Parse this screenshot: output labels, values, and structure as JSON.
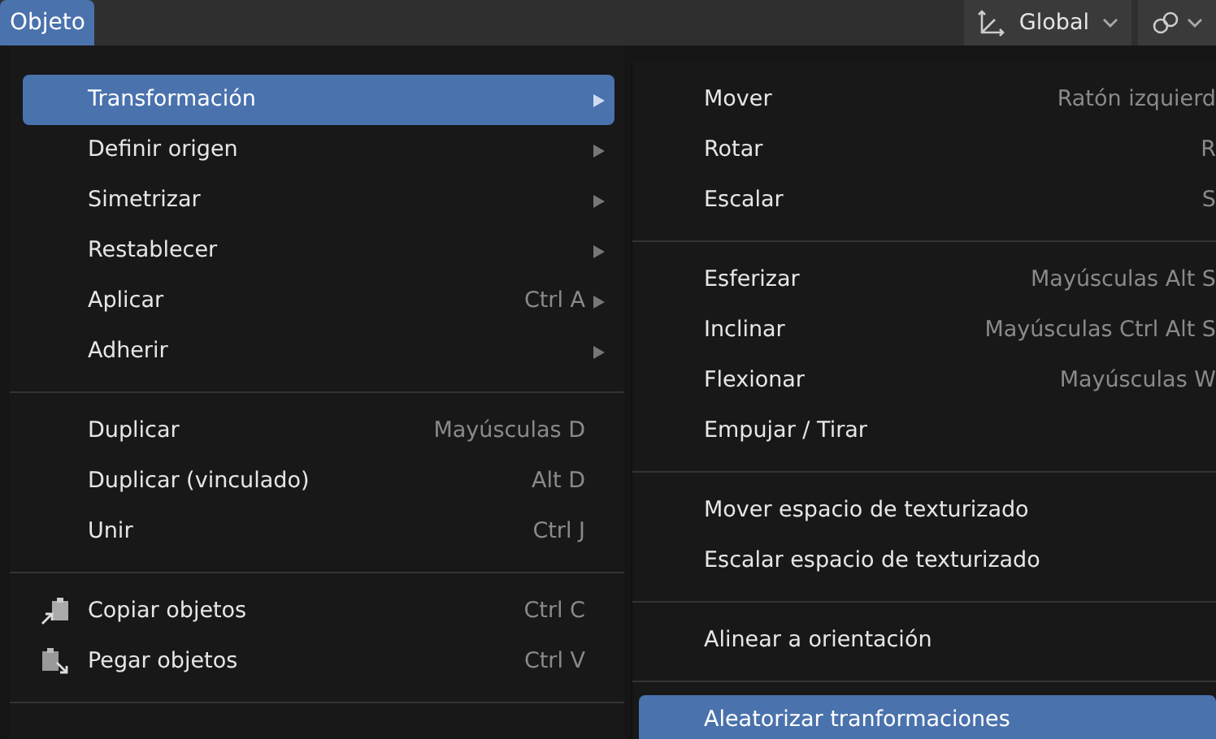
{
  "header": {
    "menu_button": {
      "label": "Objeto",
      "selected": true
    },
    "orientation": {
      "label": "Global"
    }
  },
  "menu": [
    {
      "kind": "item",
      "label": "Transformación",
      "has_submenu": true,
      "selected": true
    },
    {
      "kind": "item",
      "label": "Definir origen",
      "has_submenu": true,
      "selected": false
    },
    {
      "kind": "item",
      "label": "Simetrizar",
      "has_submenu": true,
      "selected": false
    },
    {
      "kind": "item",
      "label": "Restablecer",
      "has_submenu": true,
      "selected": false
    },
    {
      "kind": "item",
      "label": "Aplicar",
      "shortcut": "Ctrl A",
      "has_submenu": true,
      "selected": false
    },
    {
      "kind": "item",
      "label": "Adherir",
      "has_submenu": true,
      "selected": false
    },
    {
      "kind": "separator"
    },
    {
      "kind": "item",
      "label": "Duplicar",
      "shortcut": "Mayúsculas D",
      "has_submenu": false,
      "selected": false
    },
    {
      "kind": "item",
      "label": "Duplicar (vinculado)",
      "shortcut": "Alt D",
      "has_submenu": false,
      "selected": false
    },
    {
      "kind": "item",
      "label": "Unir",
      "shortcut": "Ctrl J",
      "has_submenu": false,
      "selected": false
    },
    {
      "kind": "separator"
    },
    {
      "kind": "copy",
      "label": "Copiar objetos",
      "shortcut": "Ctrl C",
      "has_submenu": false,
      "selected": false
    },
    {
      "kind": "paste",
      "label": "Pegar objetos",
      "shortcut": "Ctrl V",
      "has_submenu": false,
      "selected": false
    },
    {
      "kind": "separator"
    }
  ],
  "submenu": [
    {
      "kind": "item",
      "label": "Mover",
      "shortcut": "Ratón izquierd",
      "selected": false
    },
    {
      "kind": "item",
      "label": "Rotar",
      "shortcut": "R",
      "selected": false
    },
    {
      "kind": "item",
      "label": "Escalar",
      "shortcut": "S",
      "selected": false
    },
    {
      "kind": "separator"
    },
    {
      "kind": "item",
      "label": "Esferizar",
      "shortcut": "Mayúsculas Alt S",
      "selected": false
    },
    {
      "kind": "item",
      "label": "Inclinar",
      "shortcut": "Mayúsculas Ctrl Alt S",
      "selected": false
    },
    {
      "kind": "item",
      "label": "Flexionar",
      "shortcut": "Mayúsculas W",
      "selected": false
    },
    {
      "kind": "item",
      "label": "Empujar / Tirar",
      "selected": false
    },
    {
      "kind": "separator"
    },
    {
      "kind": "item",
      "label": "Mover espacio de texturizado",
      "selected": false
    },
    {
      "kind": "item",
      "label": "Escalar espacio de texturizado",
      "selected": false
    },
    {
      "kind": "separator"
    },
    {
      "kind": "item",
      "label": "Alinear a orientación",
      "selected": false
    },
    {
      "kind": "separator"
    },
    {
      "kind": "item",
      "label": "Aleatorizar tranformaciones",
      "selected": true
    }
  ]
}
